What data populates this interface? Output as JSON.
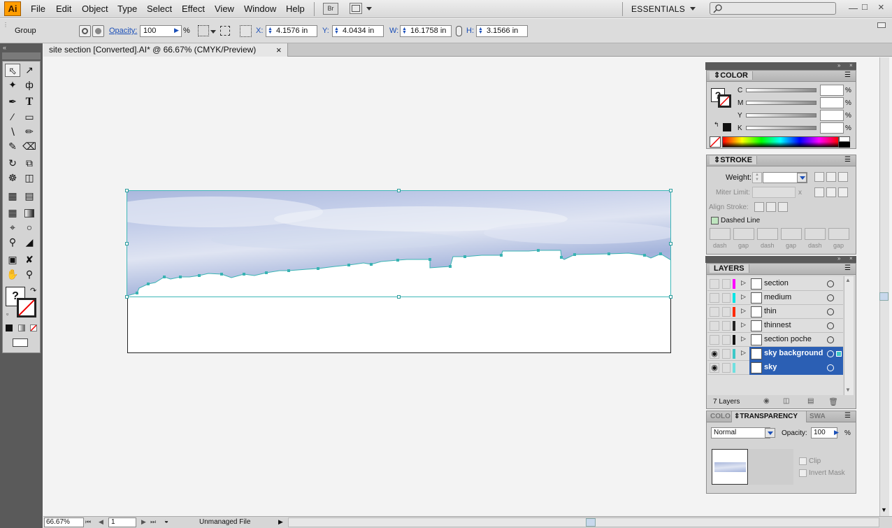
{
  "app": {
    "logo": "Ai",
    "workspace": "ESSENTIALS",
    "bridge_label": "Br"
  },
  "menu": [
    "File",
    "Edit",
    "Object",
    "Type",
    "Select",
    "Effect",
    "View",
    "Window",
    "Help"
  ],
  "control_bar": {
    "selection": "Group",
    "opacity_label": "Opacity:",
    "opacity_value": "100",
    "opacity_unit": "%",
    "x_label": "X:",
    "x_value": "4.1576 in",
    "y_label": "Y:",
    "y_value": "4.0434 in",
    "w_label": "W:",
    "w_value": "16.1758 in",
    "h_label": "H:",
    "h_value": "3.1566 in"
  },
  "document_tab": {
    "title": "site section [Converted].AI* @ 66.67% (CMYK/Preview)",
    "close": "×"
  },
  "status_bar": {
    "zoom": "66.67%",
    "artboard": "1",
    "status": "Unmanaged File"
  },
  "color_panel": {
    "title": "COLOR",
    "channels": [
      {
        "label": "C",
        "value": ""
      },
      {
        "label": "M",
        "value": ""
      },
      {
        "label": "Y",
        "value": ""
      },
      {
        "label": "K",
        "value": ""
      }
    ],
    "unit": "%"
  },
  "stroke_panel": {
    "title": "STROKE",
    "weight_label": "Weight:",
    "miter_label": "Miter Limit:",
    "miter_x": "x",
    "align_label": "Align Stroke:",
    "dashed_label": "Dashed Line",
    "dash_labels": [
      "dash",
      "gap",
      "dash",
      "gap",
      "dash",
      "gap"
    ]
  },
  "layers_panel": {
    "title": "LAYERS",
    "count": "7 Layers",
    "layers": [
      {
        "name": "section",
        "color": "#ff00ff",
        "visible": false,
        "selected": false
      },
      {
        "name": "medium",
        "color": "#00e5e5",
        "visible": false,
        "selected": false
      },
      {
        "name": "thin",
        "color": "#ff2a00",
        "visible": false,
        "selected": false
      },
      {
        "name": "thinnest",
        "color": "#222222",
        "visible": false,
        "selected": false
      },
      {
        "name": "section poche",
        "color": "#111111",
        "visible": false,
        "selected": false
      },
      {
        "name": "sky background",
        "color": "#3cc8c8",
        "visible": true,
        "selected": true
      },
      {
        "name": "sky",
        "color": "#6fe0e0",
        "visible": true,
        "selected": true
      }
    ]
  },
  "transparency_panel": {
    "tab_color": "COLO",
    "title": "TRANSPARENCY",
    "tab_swatches": "SWA",
    "blend_mode": "Normal",
    "opacity_label": "Opacity:",
    "opacity_value": "100",
    "opacity_unit": "%",
    "clip_label": "Clip",
    "invert_label": "Invert Mask"
  },
  "colors": {
    "accent": "#2b5fb4",
    "selection": "#3fb7b7",
    "logo": "#ff9d00"
  }
}
